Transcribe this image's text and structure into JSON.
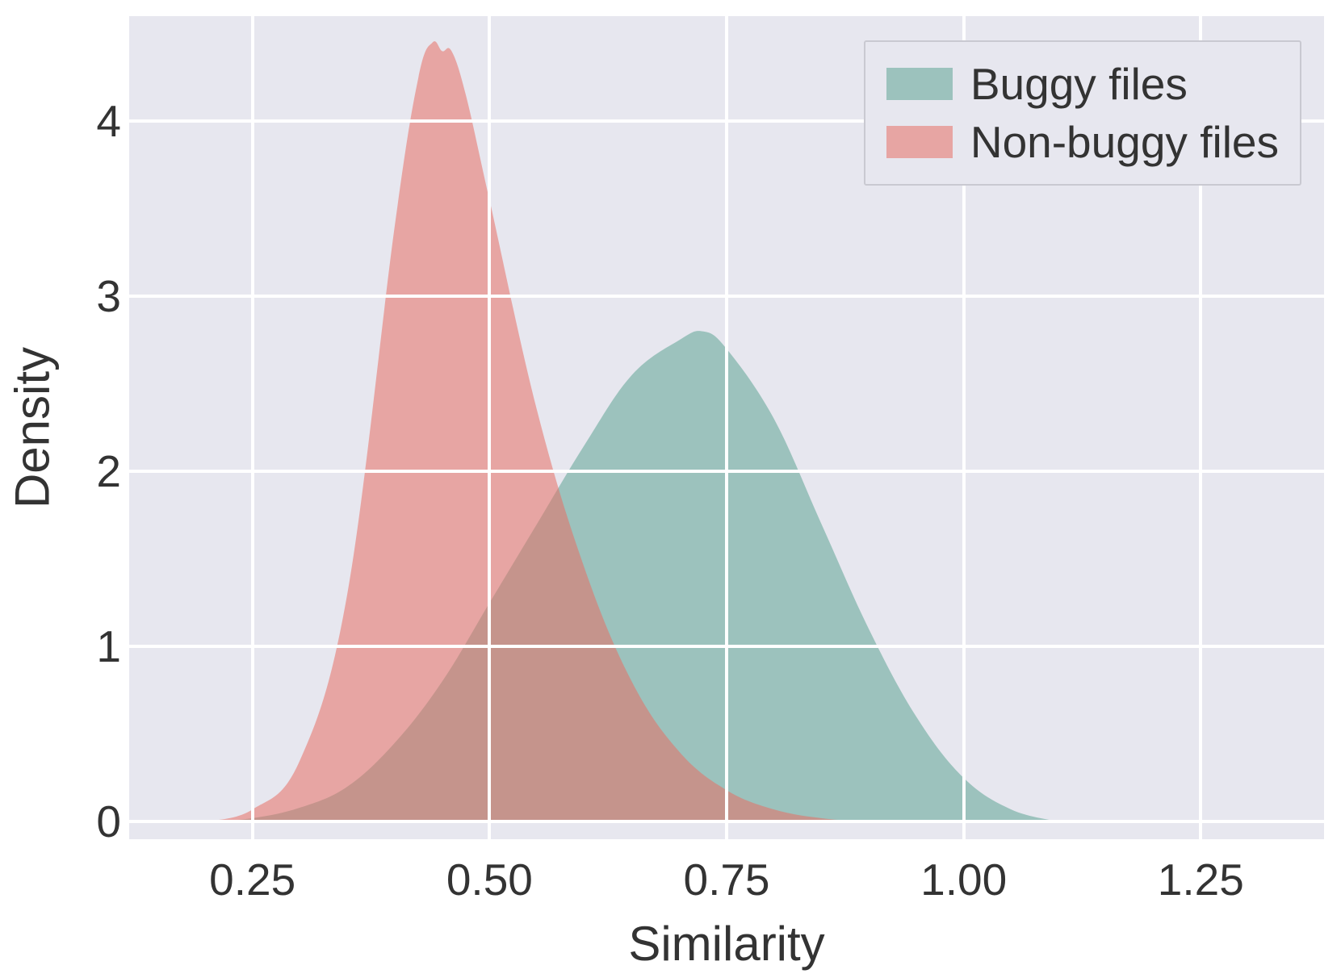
{
  "chart_data": {
    "type": "area",
    "title": "",
    "xlabel": "Similarity",
    "ylabel": "Density",
    "xlim": [
      0.12,
      1.38
    ],
    "ylim": [
      -0.1,
      4.6
    ],
    "xticks": [
      0.25,
      0.5,
      0.75,
      1.0,
      1.25
    ],
    "yticks": [
      0,
      1,
      2,
      3,
      4
    ],
    "xtick_labels": [
      "0.25",
      "0.50",
      "0.75",
      "1.00",
      "1.25"
    ],
    "ytick_labels": [
      "0",
      "1",
      "2",
      "3",
      "4"
    ],
    "grid": true,
    "legend_position": "upper right",
    "series": [
      {
        "name": "Buggy files",
        "color": "#5fa494",
        "alpha": 0.55,
        "x": [
          0.2,
          0.25,
          0.3,
          0.35,
          0.4,
          0.45,
          0.5,
          0.55,
          0.6,
          0.65,
          0.7,
          0.725,
          0.75,
          0.8,
          0.85,
          0.9,
          0.95,
          1.0,
          1.05,
          1.1
        ],
        "y": [
          0.0,
          0.02,
          0.08,
          0.2,
          0.45,
          0.8,
          1.25,
          1.7,
          2.15,
          2.55,
          2.75,
          2.8,
          2.7,
          2.3,
          1.7,
          1.1,
          0.6,
          0.25,
          0.07,
          0.0
        ]
      },
      {
        "name": "Non-buggy files",
        "color": "#e77064",
        "alpha": 0.55,
        "x": [
          0.2,
          0.25,
          0.3,
          0.35,
          0.4,
          0.425,
          0.44,
          0.45,
          0.46,
          0.475,
          0.5,
          0.55,
          0.6,
          0.65,
          0.7,
          0.75,
          0.8,
          0.85,
          0.9
        ],
        "y": [
          0.0,
          0.07,
          0.35,
          1.3,
          3.4,
          4.25,
          4.45,
          4.4,
          4.4,
          4.15,
          3.55,
          2.35,
          1.45,
          0.8,
          0.4,
          0.18,
          0.07,
          0.02,
          0.0
        ]
      }
    ]
  },
  "legend": {
    "items": [
      "Buggy files",
      "Non-buggy files"
    ]
  }
}
